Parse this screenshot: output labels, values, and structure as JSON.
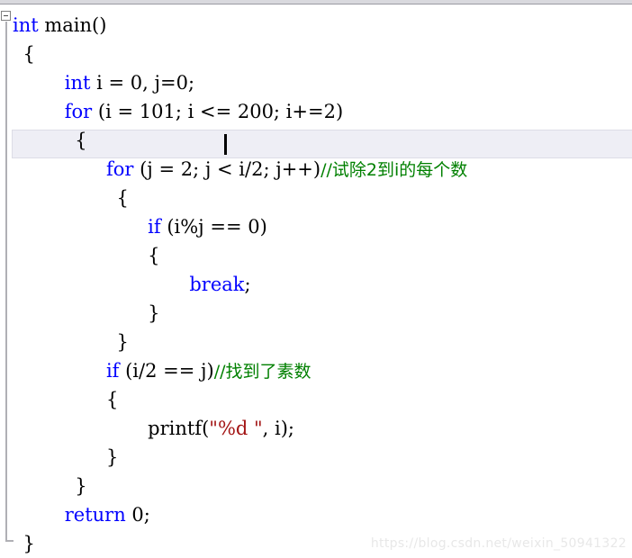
{
  "editor": {
    "language": "C",
    "colors": {
      "keyword": "#0000FF",
      "comment": "#008000",
      "string": "#A31515",
      "text": "#000000",
      "current_line_highlight": "#EEEEF5",
      "fold_line": "#B0B0B5"
    },
    "outlining": {
      "collapse_symbol": "minus-square-icon",
      "expanded": true
    },
    "caret": {
      "visible": true,
      "line_index": 4,
      "after_text": "for (j = 2"
    },
    "current_line_index": 4,
    "lines": [
      {
        "indent": "",
        "tokens": [
          {
            "kind": "kw",
            "text": "int"
          },
          {
            "kind": "pun",
            "text": " main()"
          }
        ]
      },
      {
        "indent": " ",
        "tokens": [
          {
            "kind": "pun",
            "text": "{"
          }
        ]
      },
      {
        "indent": "     ",
        "tokens": [
          {
            "kind": "kw",
            "text": "int"
          },
          {
            "kind": "pun",
            "text": " i = 0, j=0;"
          }
        ]
      },
      {
        "indent": "     ",
        "tokens": [
          {
            "kind": "kw",
            "text": "for"
          },
          {
            "kind": "pun",
            "text": " (i = 101; i <= 200; i+=2)"
          }
        ]
      },
      {
        "indent": "      ",
        "tokens": [
          {
            "kind": "pun",
            "text": "{"
          }
        ]
      },
      {
        "indent": "         ",
        "tokens": [
          {
            "kind": "kw",
            "text": "for"
          },
          {
            "kind": "pun",
            "text": " (j = 2; j < i/2; j++)"
          },
          {
            "kind": "cmt",
            "text": "//试除2到i的每个数"
          }
        ]
      },
      {
        "indent": "          ",
        "tokens": [
          {
            "kind": "pun",
            "text": "{"
          }
        ]
      },
      {
        "indent": "             ",
        "tokens": [
          {
            "kind": "kw",
            "text": "if"
          },
          {
            "kind": "pun",
            "text": " (i%j == 0)"
          }
        ]
      },
      {
        "indent": "             ",
        "tokens": [
          {
            "kind": "pun",
            "text": "{"
          }
        ]
      },
      {
        "indent": "                 ",
        "tokens": [
          {
            "kind": "kw",
            "text": "break"
          },
          {
            "kind": "pun",
            "text": ";"
          }
        ]
      },
      {
        "indent": "             ",
        "tokens": [
          {
            "kind": "pun",
            "text": "}"
          }
        ]
      },
      {
        "indent": "          ",
        "tokens": [
          {
            "kind": "pun",
            "text": "}"
          }
        ]
      },
      {
        "indent": "         ",
        "tokens": [
          {
            "kind": "kw",
            "text": "if"
          },
          {
            "kind": "pun",
            "text": " (i/2 == j)"
          },
          {
            "kind": "cmt",
            "text": "//找到了素数"
          }
        ]
      },
      {
        "indent": "         ",
        "tokens": [
          {
            "kind": "pun",
            "text": "{"
          }
        ]
      },
      {
        "indent": "             ",
        "tokens": [
          {
            "kind": "pun",
            "text": "printf("
          },
          {
            "kind": "str",
            "text": "\"%d \""
          },
          {
            "kind": "pun",
            "text": ", i);"
          }
        ]
      },
      {
        "indent": "         ",
        "tokens": [
          {
            "kind": "pun",
            "text": "}"
          }
        ]
      },
      {
        "indent": "      ",
        "tokens": [
          {
            "kind": "pun",
            "text": "}"
          }
        ]
      },
      {
        "indent": "     ",
        "tokens": [
          {
            "kind": "kw",
            "text": "return"
          },
          {
            "kind": "pun",
            "text": " 0;"
          }
        ]
      },
      {
        "indent": " ",
        "tokens": [
          {
            "kind": "pun",
            "text": "}"
          }
        ]
      }
    ]
  },
  "watermark": {
    "text": "https://blog.csdn.net/weixin_50941322"
  }
}
